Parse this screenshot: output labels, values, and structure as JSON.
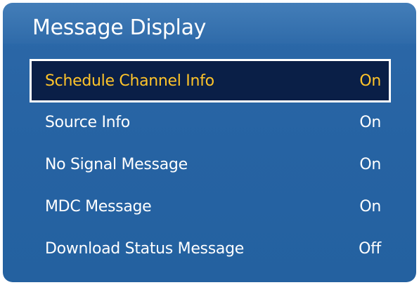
{
  "window": {
    "title": "Message Display"
  },
  "menu": {
    "items": [
      {
        "label": "Schedule Channel Info",
        "value": "On",
        "selected": true
      },
      {
        "label": "Source Info",
        "value": "On",
        "selected": false
      },
      {
        "label": "No Signal Message",
        "value": "On",
        "selected": false
      },
      {
        "label": "MDC Message",
        "value": "On",
        "selected": false
      },
      {
        "label": "Download Status Message",
        "value": "Off",
        "selected": false
      }
    ]
  },
  "colors": {
    "panel_background": "#2663a3",
    "selected_background": "#0a1f47",
    "selected_text": "#ffc42a",
    "text": "#ffffff"
  }
}
